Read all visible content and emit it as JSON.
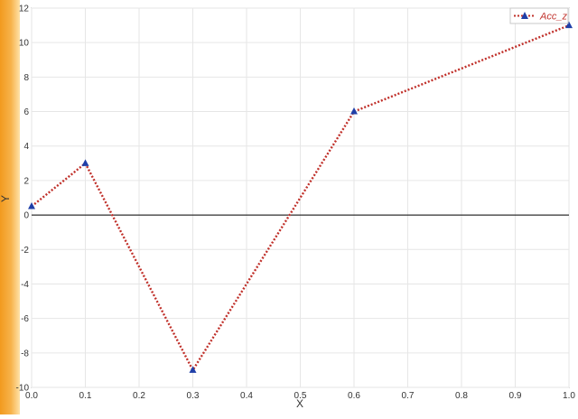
{
  "chart_data": {
    "type": "line",
    "title": "",
    "xlabel": "X",
    "ylabel": "Y",
    "xlim": [
      0.0,
      1.0
    ],
    "ylim": [
      -10,
      12
    ],
    "x_ticks": [
      "0.0",
      "0.1",
      "0.2",
      "0.3",
      "0.4",
      "0.5",
      "0.6",
      "0.7",
      "0.8",
      "0.9",
      "1.0"
    ],
    "y_ticks": [
      "12",
      "10",
      "8",
      "6",
      "4",
      "2",
      "0",
      "-2",
      "-4",
      "-6",
      "-8",
      "-10"
    ],
    "grid": true,
    "legend_position": "top-right",
    "series": [
      {
        "name": "Acc_z",
        "line_style": "dotted",
        "marker": "triangle",
        "line_color": "#c0302a",
        "marker_color": "#1f3fa8",
        "x": [
          0.0,
          0.1,
          0.3,
          0.6,
          1.0
        ],
        "y": [
          0.5,
          3.0,
          -9.0,
          6.0,
          11.0
        ]
      }
    ]
  },
  "colors": {
    "accent_bar_light": "#ffd68a",
    "accent_bar_dark": "#f29a1e",
    "zero_line": "#000000",
    "grid": "#e6e6e6",
    "axis_text": "#333333"
  }
}
